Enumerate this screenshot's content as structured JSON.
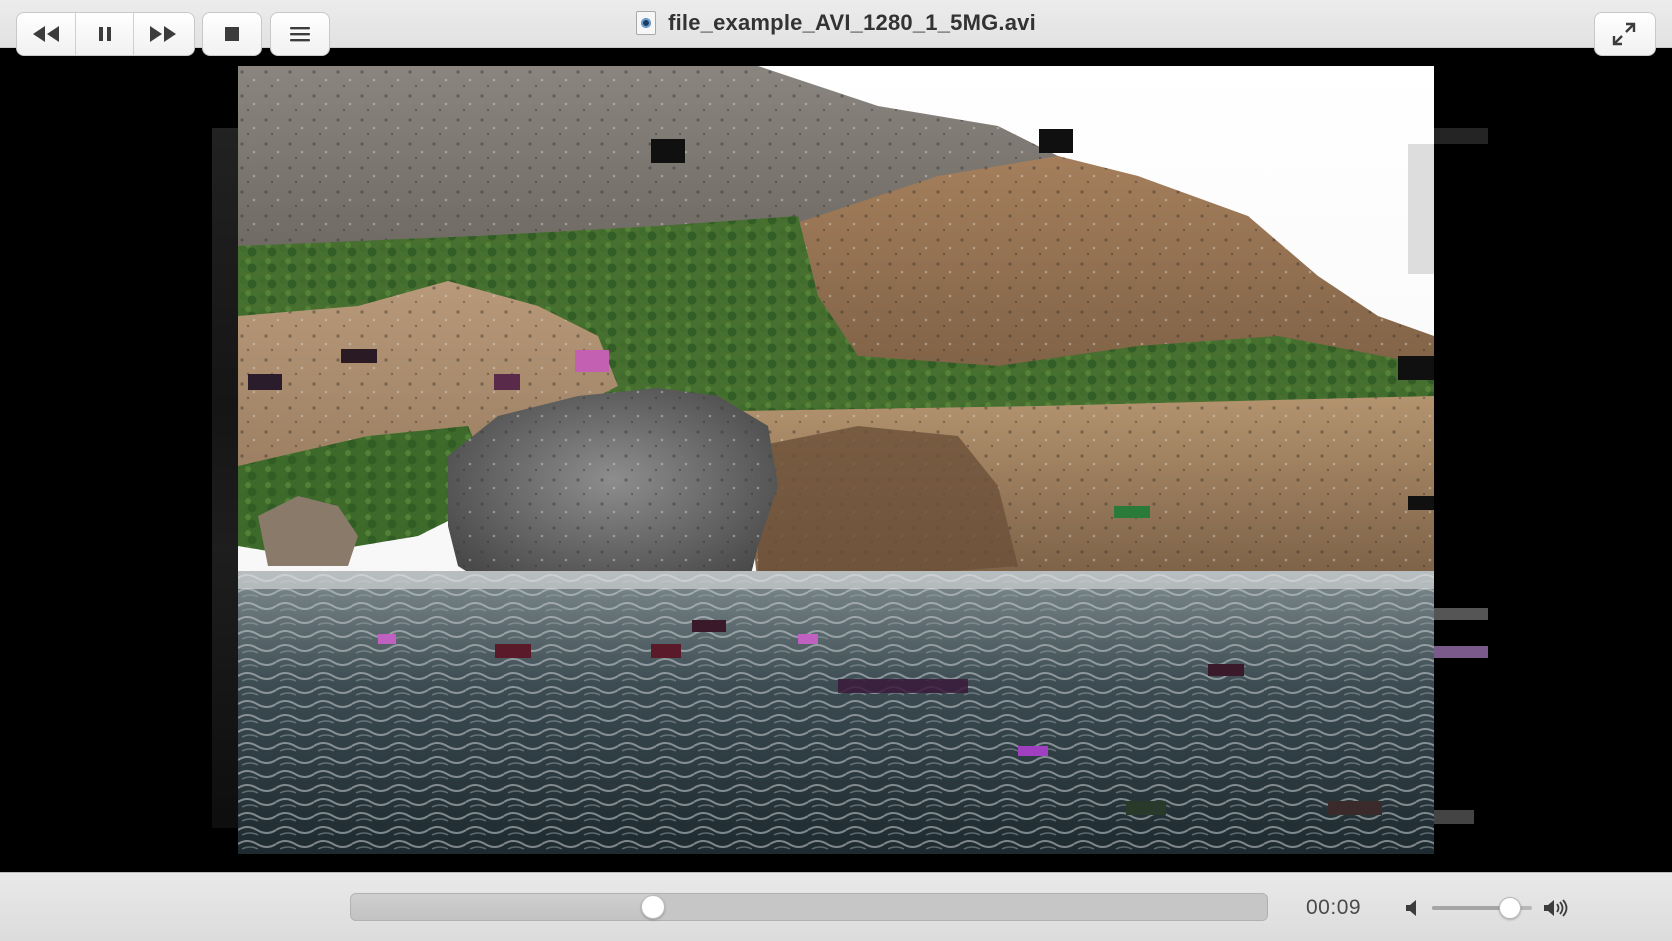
{
  "window": {
    "title": "file_example_AVI_1280_1_5MG.avi",
    "file_icon": "video-file-icon"
  },
  "traffic_lights": {
    "close": {
      "icon": "close-icon",
      "color": "#fe5f57"
    },
    "minimize": {
      "icon": "minimize-icon",
      "color": "#febc2e"
    },
    "maximize": {
      "icon": "maximize-icon",
      "color": "#28c840"
    }
  },
  "video": {
    "content": "video-frame",
    "background": "#000000"
  },
  "controls": {
    "rewind": {
      "icon": "rewind-icon"
    },
    "pause": {
      "icon": "pause-icon"
    },
    "fast_forward": {
      "icon": "fast-forward-icon"
    },
    "stop": {
      "icon": "stop-icon"
    },
    "playlist": {
      "icon": "playlist-icon"
    },
    "elapsed_time": "00:09",
    "playback_progress": 0.33,
    "volume_low": {
      "icon": "volume-low-icon"
    },
    "volume_high": {
      "icon": "volume-high-icon"
    },
    "volume_level": 0.78,
    "fullscreen": {
      "icon": "fullscreen-icon"
    }
  }
}
